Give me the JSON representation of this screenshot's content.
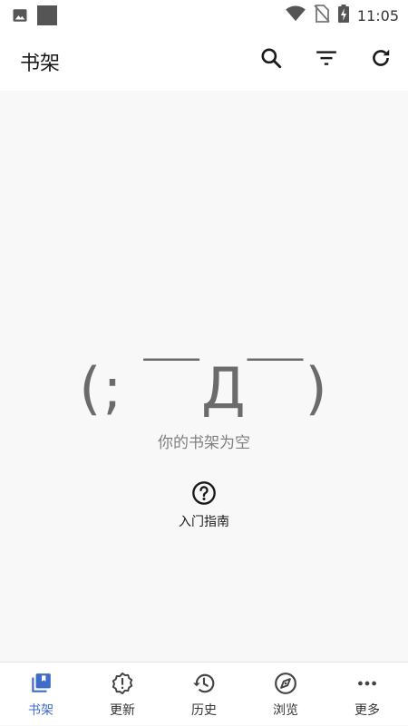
{
  "status_bar": {
    "time": "11:05",
    "icons": [
      "image-icon",
      "square-icon",
      "wifi-icon",
      "no-sim-icon",
      "battery-charging-icon"
    ]
  },
  "app_bar": {
    "title": "书架",
    "actions": [
      "search-icon",
      "filter-icon",
      "refresh-icon"
    ]
  },
  "empty_state": {
    "kaomoji": "(; ￣Д￣)",
    "message": "你的书架为空",
    "guide_label": "入门指南",
    "guide_icon": "help-circle-icon"
  },
  "bottom_nav": {
    "items": [
      {
        "label": "书架",
        "icon": "library-icon",
        "active": true
      },
      {
        "label": "更新",
        "icon": "update-alert-icon",
        "active": false
      },
      {
        "label": "历史",
        "icon": "history-icon",
        "active": false
      },
      {
        "label": "浏览",
        "icon": "compass-icon",
        "active": false
      },
      {
        "label": "更多",
        "icon": "more-dots-icon",
        "active": false
      }
    ]
  },
  "colors": {
    "accent": "#3f6cc8",
    "background": "#f8f8f8",
    "surface": "#ffffff",
    "muted_text": "#808080"
  }
}
